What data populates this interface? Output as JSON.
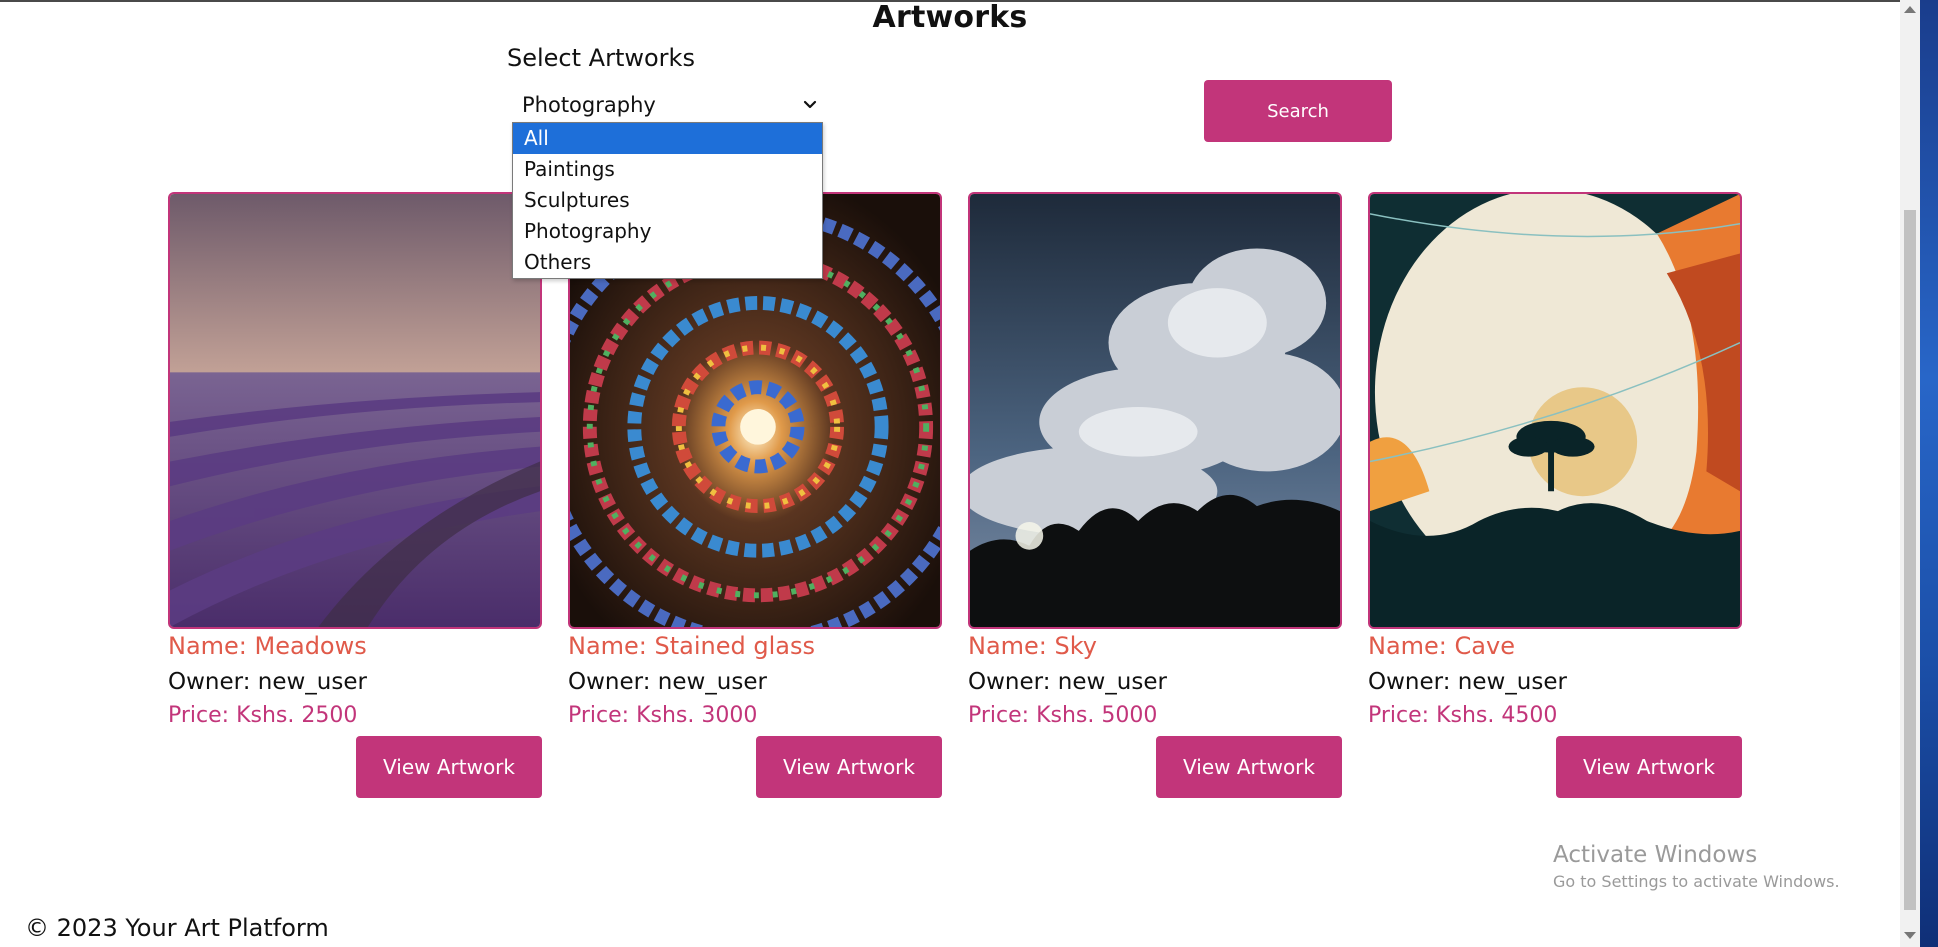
{
  "page": {
    "title": "Artworks"
  },
  "filter": {
    "label": "Select Artworks",
    "selected": "Photography",
    "options": [
      "All",
      "Paintings",
      "Sculptures",
      "Photography",
      "Others"
    ],
    "highlighted_option": "All",
    "search_label": "Search"
  },
  "artworks": [
    {
      "name": "Name: Meadows",
      "owner": "Owner: new_user",
      "price": "Price: Kshs. 2500",
      "button": "View Artwork"
    },
    {
      "name": "Name: Stained glass",
      "owner": "Owner: new_user",
      "price": "Price: Kshs. 3000",
      "button": "View Artwork"
    },
    {
      "name": "Name: Sky",
      "owner": "Owner: new_user",
      "price": "Price: Kshs. 5000",
      "button": "View Artwork"
    },
    {
      "name": "Name: Cave",
      "owner": "Owner: new_user",
      "price": "Price: Kshs. 4500",
      "button": "View Artwork"
    }
  ],
  "watermark": {
    "title": "Activate Windows",
    "subtitle": "Go to Settings to activate Windows."
  },
  "footer": {
    "text": "© 2023 Your Art Platform"
  },
  "colors": {
    "accent": "#c2357a",
    "name_text": "#e05a4a",
    "price_text": "#c2357a",
    "dropdown_highlight": "#1e6fd9"
  }
}
